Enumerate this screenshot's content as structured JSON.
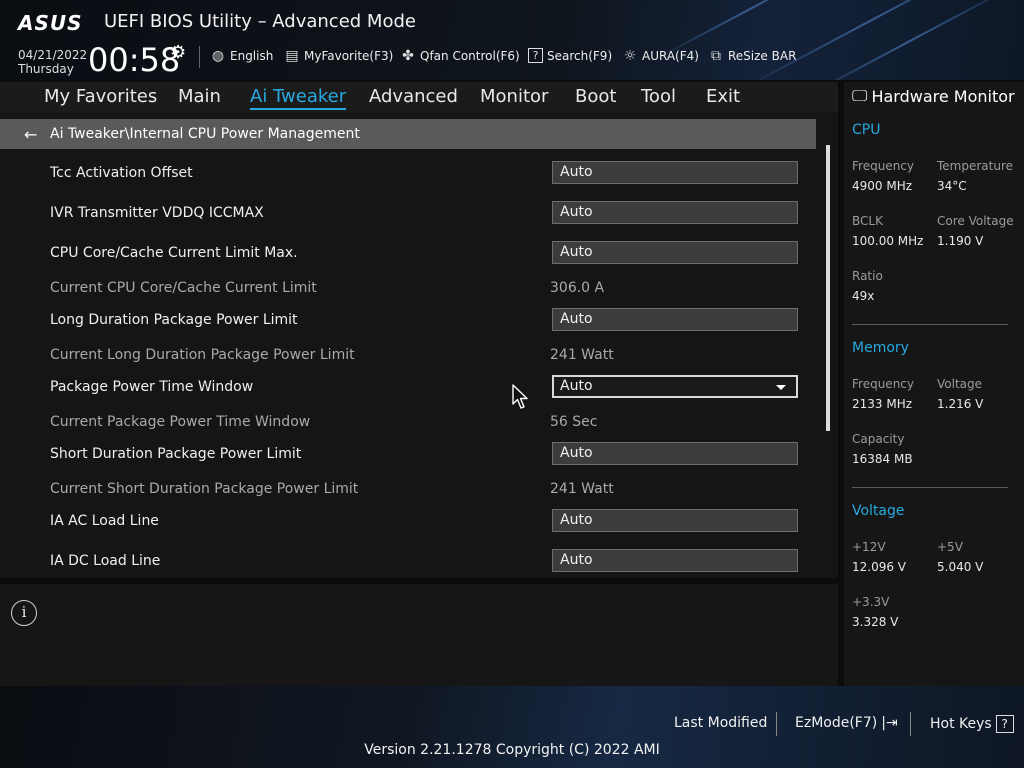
{
  "header": {
    "logo": "ASUS",
    "title": "UEFI BIOS Utility – Advanced Mode",
    "date": "04/21/2022",
    "day": "Thursday",
    "time": "00:58",
    "tools": [
      {
        "icon": "globe-icon",
        "label": "English"
      },
      {
        "icon": "keyboard-icon",
        "label": "MyFavorite(F3)"
      },
      {
        "icon": "fan-icon",
        "label": "Qfan Control(F6)"
      },
      {
        "icon": "question-icon",
        "label": "Search(F9)"
      },
      {
        "icon": "aura-icon",
        "label": "AURA(F4)"
      },
      {
        "icon": "resize-bar-icon",
        "label": "ReSize BAR"
      }
    ]
  },
  "nav": {
    "items": [
      "My Favorites",
      "Main",
      "Ai Tweaker",
      "Advanced",
      "Monitor",
      "Boot",
      "Tool",
      "Exit"
    ],
    "active": "Ai Tweaker"
  },
  "main": {
    "breadcrumb": "Ai Tweaker\\Internal CPU Power Management",
    "rows": [
      {
        "label": "Tcc Activation Offset",
        "value": "Auto",
        "type": "box"
      },
      {
        "label": "IVR Transmitter VDDQ ICCMAX",
        "value": "Auto",
        "type": "box"
      },
      {
        "label": "CPU Core/Cache Current Limit Max.",
        "value": "Auto",
        "type": "box"
      },
      {
        "label": "Current CPU Core/Cache Current Limit",
        "value": "306.0 A",
        "type": "readonly"
      },
      {
        "label": "Long Duration Package Power Limit",
        "value": "Auto",
        "type": "box"
      },
      {
        "label": "Current Long Duration Package Power Limit",
        "value": "241 Watt",
        "type": "readonly"
      },
      {
        "label": "Package Power Time Window",
        "value": "Auto",
        "type": "dropdown"
      },
      {
        "label": "Current Package Power Time Window",
        "value": "56 Sec",
        "type": "readonly"
      },
      {
        "label": "Short Duration Package Power Limit",
        "value": "Auto",
        "type": "box"
      },
      {
        "label": "Current Short Duration Package Power Limit",
        "value": "241 Watt",
        "type": "readonly"
      },
      {
        "label": "IA AC Load Line",
        "value": "Auto",
        "type": "box"
      },
      {
        "label": "IA DC Load Line",
        "value": "Auto",
        "type": "box"
      }
    ]
  },
  "hardware_monitor": {
    "title": "Hardware Monitor",
    "cpu": {
      "heading": "CPU",
      "frequency_label": "Frequency",
      "frequency": "4900 MHz",
      "temperature_label": "Temperature",
      "temperature": "34°C",
      "bclk_label": "BCLK",
      "bclk": "100.00 MHz",
      "core_voltage_label": "Core Voltage",
      "core_voltage": "1.190 V",
      "ratio_label": "Ratio",
      "ratio": "49x"
    },
    "memory": {
      "heading": "Memory",
      "frequency_label": "Frequency",
      "frequency": "2133 MHz",
      "voltage_label": "Voltage",
      "voltage": "1.216 V",
      "capacity_label": "Capacity",
      "capacity": "16384 MB"
    },
    "voltage": {
      "heading": "Voltage",
      "v12_label": "+12V",
      "v12": "12.096 V",
      "v5_label": "+5V",
      "v5": "5.040 V",
      "v33_label": "+3.3V",
      "v33": "3.328 V"
    }
  },
  "footer": {
    "last_modified": "Last Modified",
    "ezmode": "EzMode(F7)",
    "hotkeys": "Hot Keys",
    "hotkeys_key": "?",
    "version": "Version 2.21.1278 Copyright (C) 2022 AMI"
  },
  "colors": {
    "accent": "#27a9e0",
    "panel": "#151515",
    "breadcrumb_bg": "#5a5a5a"
  }
}
